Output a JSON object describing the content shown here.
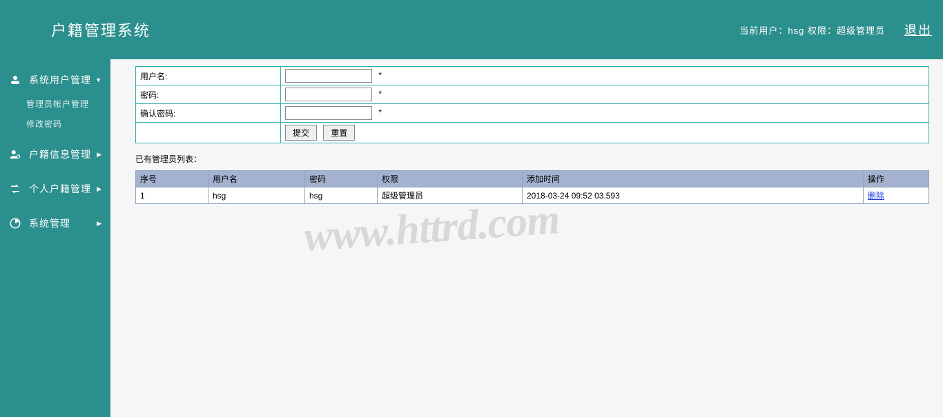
{
  "header": {
    "title": "户籍管理系统",
    "current_user_label": "当前用户：hsg  权限：超级管理员",
    "logout": "退出"
  },
  "sidebar": {
    "items": [
      {
        "label": "系统用户管理",
        "expanded": true,
        "subitems": [
          "管理员帐户管理",
          "修改密码"
        ]
      },
      {
        "label": "户籍信息管理",
        "expanded": false
      },
      {
        "label": "个人户籍管理",
        "expanded": false
      },
      {
        "label": "系统管理",
        "expanded": false
      }
    ]
  },
  "form": {
    "rows": [
      {
        "label": "用户名:",
        "star": "*"
      },
      {
        "label": "密码:",
        "star": "*"
      },
      {
        "label": "确认密码:",
        "star": "*"
      }
    ],
    "submit": "提交",
    "reset": "重置"
  },
  "list": {
    "caption": "已有管理员列表：",
    "columns": [
      "序号",
      "用户名",
      "密码",
      "权限",
      "添加时间",
      "操作"
    ],
    "rows": [
      {
        "seq": "1",
        "user": "hsg",
        "pwd": "hsg",
        "role": "超级管理员",
        "time": "2018-03-24 09:52 03.593",
        "op": "删除"
      }
    ]
  },
  "watermark": "www.httrd.com"
}
